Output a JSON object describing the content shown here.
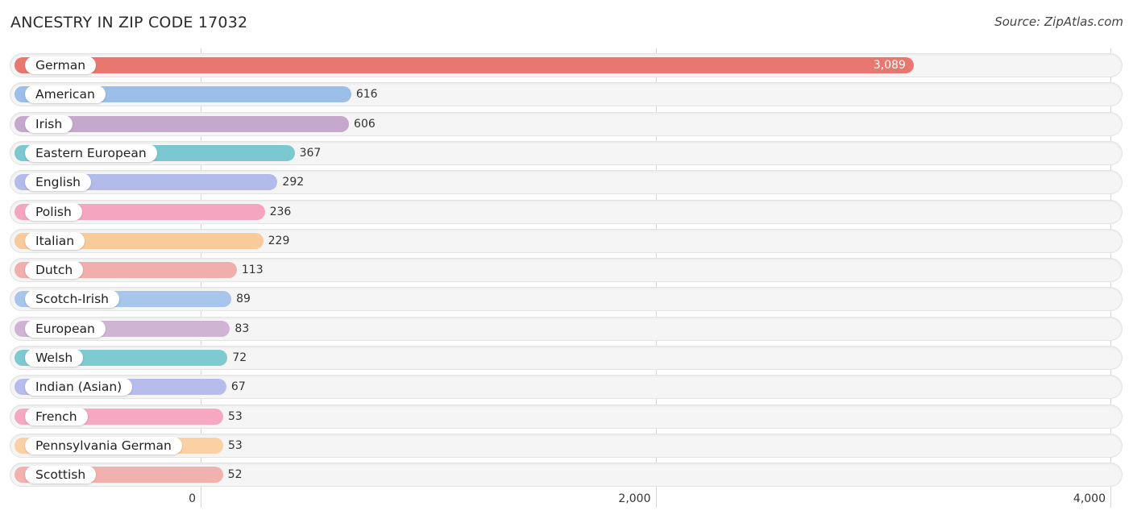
{
  "header": {
    "title": "ANCESTRY IN ZIP CODE 17032",
    "source": "Source: ZipAtlas.com"
  },
  "chart_data": {
    "type": "bar",
    "orientation": "horizontal",
    "title": "ANCESTRY IN ZIP CODE 17032",
    "xlabel": "",
    "ylabel": "",
    "xlim": [
      0,
      4000
    ],
    "grid": true,
    "x_ticks": [
      {
        "value": 0,
        "label": "0"
      },
      {
        "value": 2000,
        "label": "2,000"
      },
      {
        "value": 4000,
        "label": "4,000"
      }
    ],
    "categories": [
      "German",
      "American",
      "Irish",
      "Eastern European",
      "English",
      "Polish",
      "Italian",
      "Dutch",
      "Scotch-Irish",
      "European",
      "Welsh",
      "Indian (Asian)",
      "French",
      "Pennsylvania German",
      "Scottish"
    ],
    "values": [
      3089,
      616,
      606,
      367,
      292,
      236,
      229,
      113,
      89,
      83,
      72,
      67,
      53,
      53,
      52
    ],
    "value_labels": [
      "3,089",
      "616",
      "606",
      "367",
      "292",
      "236",
      "229",
      "113",
      "89",
      "83",
      "72",
      "67",
      "53",
      "53",
      "52"
    ],
    "colors": [
      "#e8776f",
      "#9bbfe8",
      "#c7a8cd",
      "#7cc8d0",
      "#b3bbeb",
      "#f5a5c0",
      "#f9ca9a",
      "#f0aeac",
      "#a6c6eb",
      "#cfb4d4",
      "#7ecad1",
      "#b6bdec",
      "#f6a8c2",
      "#fad0a4",
      "#f1b1ae"
    ]
  }
}
